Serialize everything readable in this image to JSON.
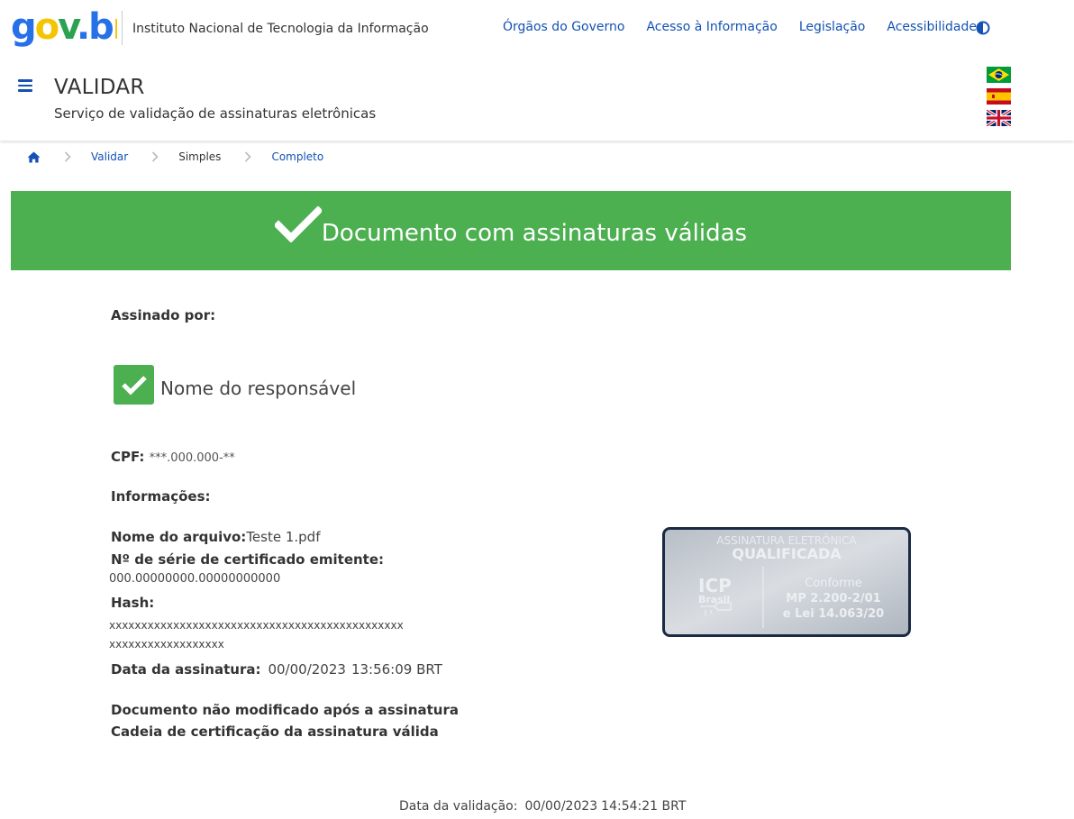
{
  "header": {
    "logo_text": "gov.br",
    "institute": "Instituto Nacional de Tecnologia da Informação",
    "links": [
      "Órgãos do Governo",
      "Acesso à Informação",
      "Legislação",
      "Acessibilidade"
    ],
    "contrast_icon": "contrast-icon"
  },
  "service": {
    "title": "VALIDAR",
    "subtitle": "Serviço de validação de assinaturas eletrônicas",
    "menu_icon": "hamburger-menu-icon",
    "flags": [
      "flag-brazil",
      "flag-spain",
      "flag-uk"
    ]
  },
  "breadcrumb": {
    "home_icon": "home-icon",
    "items": [
      "Validar",
      "Simples",
      "Completo"
    ]
  },
  "banner": {
    "text": "Documento com assinaturas válidas",
    "color": "#4caf50"
  },
  "signature": {
    "assinado_label": "Assinado por:",
    "signer_name": "Nome do responsável",
    "cpf_label": "CPF:",
    "cpf_value": "***.000.000-**",
    "info_label": "Informações:",
    "file_label": "Nome do arquivo:",
    "file_value": "Teste 1.pdf",
    "serial_label": "Nº de série de certificado emitente:",
    "serial_value": "000.00000000.00000000000",
    "hash_label": "Hash:",
    "hash_line1": "xxxxxxxxxxxxxxxxxxxxxxxxxxxxxxxxxxxxxxxxxxxxxx",
    "hash_line2": "xxxxxxxxxxxxxxxxxx",
    "date_label": "Data da assinatura:",
    "date_value": "00/00/2023",
    "time_value": "13:56:09 BRT",
    "status_unmodified": "Documento não modificado após a assinatura",
    "status_chain": "Cadeia de certificação da assinatura válida"
  },
  "seal": {
    "line1": "ASSINATURA ELETRÔNICA",
    "line2": "QUALIFICADA",
    "icp1": "ICP",
    "icp2": "Brasil",
    "conforme": "Conforme",
    "mp": "MP 2.200-2/01",
    "lei": "e Lei 14.063/20"
  },
  "footer": {
    "label": "Data da validação:",
    "date": "00/00/2023",
    "time": "14:54:21 BRT"
  },
  "colors": {
    "link": "#1351b4",
    "success": "#4caf50"
  }
}
